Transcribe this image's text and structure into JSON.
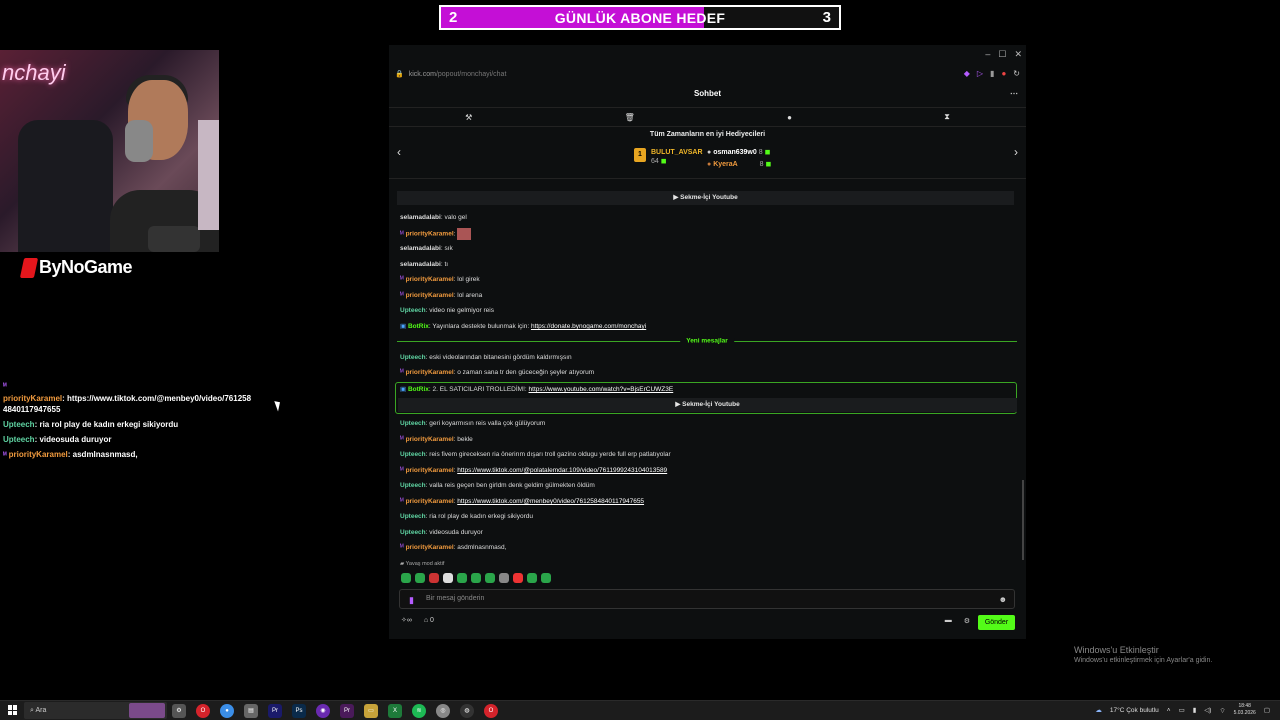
{
  "goal": {
    "left_count": "2",
    "title": "GÜNLÜK ABONE HEDEF",
    "right_count": "3",
    "progress": 0.66
  },
  "webcam": {
    "neon_text": "nchayi"
  },
  "sponsor": {
    "name": "ByNoGame"
  },
  "overlay_chat": [
    {
      "user": "priorityKaramel",
      "text": "https://www.tiktok.com/@menbey0/video/7612584840117947655",
      "color": "orange",
      "badge": true
    },
    {
      "user": "Upteech",
      "text": "ria rol play de kadın erkegi sikiyordu",
      "color": "green",
      "badge": false
    },
    {
      "user": "Upteech",
      "text": "videosuda duruyor",
      "color": "green",
      "badge": false
    },
    {
      "user": "priorityKaramel",
      "text": "asdmlnasnmasd,",
      "color": "orange",
      "badge": true
    }
  ],
  "popup": {
    "window_controls": [
      "–",
      "☐",
      "✕"
    ],
    "url_host": "kick.com",
    "url_path": "/popout/monchayi/chat",
    "header_title": "Sohbet",
    "gifters_title": "Tüm Zamanların en iyi Hediyecileri",
    "gifters": [
      {
        "name": "BULUT_AVSAR",
        "count": "64"
      },
      {
        "name": "osman639w0",
        "count": "8"
      },
      {
        "name": "KyeraA",
        "count": "8"
      }
    ],
    "youtube_label": "Sekme-İçi Youtube",
    "new_messages_label": "Yeni mesajlar",
    "messages": [
      {
        "user": "selamadalabi",
        "text": "valo gel",
        "color": "white"
      },
      {
        "user": "priorityKaramel",
        "text": "",
        "color": "orange",
        "badge": true,
        "emote": true
      },
      {
        "user": "selamadalabi",
        "text": "sık",
        "color": "white"
      },
      {
        "user": "selamadalabi",
        "text": "tı",
        "color": "white"
      },
      {
        "user": "priorityKaramel",
        "text": "lol girek",
        "color": "orange",
        "badge": true
      },
      {
        "user": "priorityKaramel",
        "text": "lol arena",
        "color": "orange",
        "badge": true
      },
      {
        "user": "Upteech",
        "text": "video nie gelmiyor reis",
        "color": "green"
      },
      {
        "user": "BotRix",
        "text": "Yayınlara destekte bulunmak için:",
        "link": "https://donate.bynogame.com/monchayi",
        "color": "bot"
      },
      {
        "user": "Upteech",
        "text": "eski videolarından bitanesini gördüm kaldırmışsın",
        "color": "green"
      },
      {
        "user": "priorityKaramel",
        "text": "o zaman sana tr den güceceğin şeyler atıyorum",
        "color": "orange",
        "badge": true
      },
      {
        "user": "BotRix",
        "text": "2. EL SATICILARI TROLLEDİM!:",
        "link": "https://www.youtube.com/watch?v=BjsErCUWZ3E",
        "color": "bot"
      },
      {
        "user": "Upteech",
        "text": "geri koyarmısın reis valla çok gülüyorum",
        "color": "green"
      },
      {
        "user": "priorityKaramel",
        "text": "bekle",
        "color": "orange",
        "badge": true
      },
      {
        "user": "Upteech",
        "text": "reis fivem gireceksen ria önerirım dışarı troll gazino oldugu yerde full erp patlatıyolar",
        "color": "green"
      },
      {
        "user": "priorityKaramel",
        "text": "",
        "link": "https://www.tiktok.com/@polatalemdar.109/video/7611999243104013589",
        "color": "orange",
        "badge": true
      },
      {
        "user": "Upteech",
        "text": "valla reis geçen ben girldm denk geldim gülmekten öldüm",
        "color": "green"
      },
      {
        "user": "priorityKaramel",
        "text": "",
        "link": "https://www.tiktok.com/@menbey0/video/7612584840117947655",
        "color": "orange",
        "badge": true
      },
      {
        "user": "Upteech",
        "text": "ria rol play de kadın erkegi sikiyordu",
        "color": "green"
      },
      {
        "user": "Upteech",
        "text": "videosuda duruyor",
        "color": "green"
      },
      {
        "user": "priorityKaramel",
        "text": "asdmlnasnmasd,",
        "color": "orange",
        "badge": true
      }
    ],
    "slow_mode": "Yavaş mod aktif",
    "input_placeholder": "Bir mesaj gönderin",
    "points": "0",
    "send_label": "Gönder"
  },
  "watermark": {
    "title": "Windows'u Etkinleştir",
    "subtitle": "Windows'u etkinleştirmek için Ayarlar'a gidin."
  },
  "taskbar": {
    "search_placeholder": "Ara",
    "weather": "17°C  Çok bulutlu",
    "time": "18:48",
    "date": "5.03.2026"
  },
  "colors": {
    "kick_green": "#53fc18",
    "goal_purple": "#c40fd6",
    "username_orange": "#f09a3e",
    "username_green": "#5fd3a2"
  }
}
